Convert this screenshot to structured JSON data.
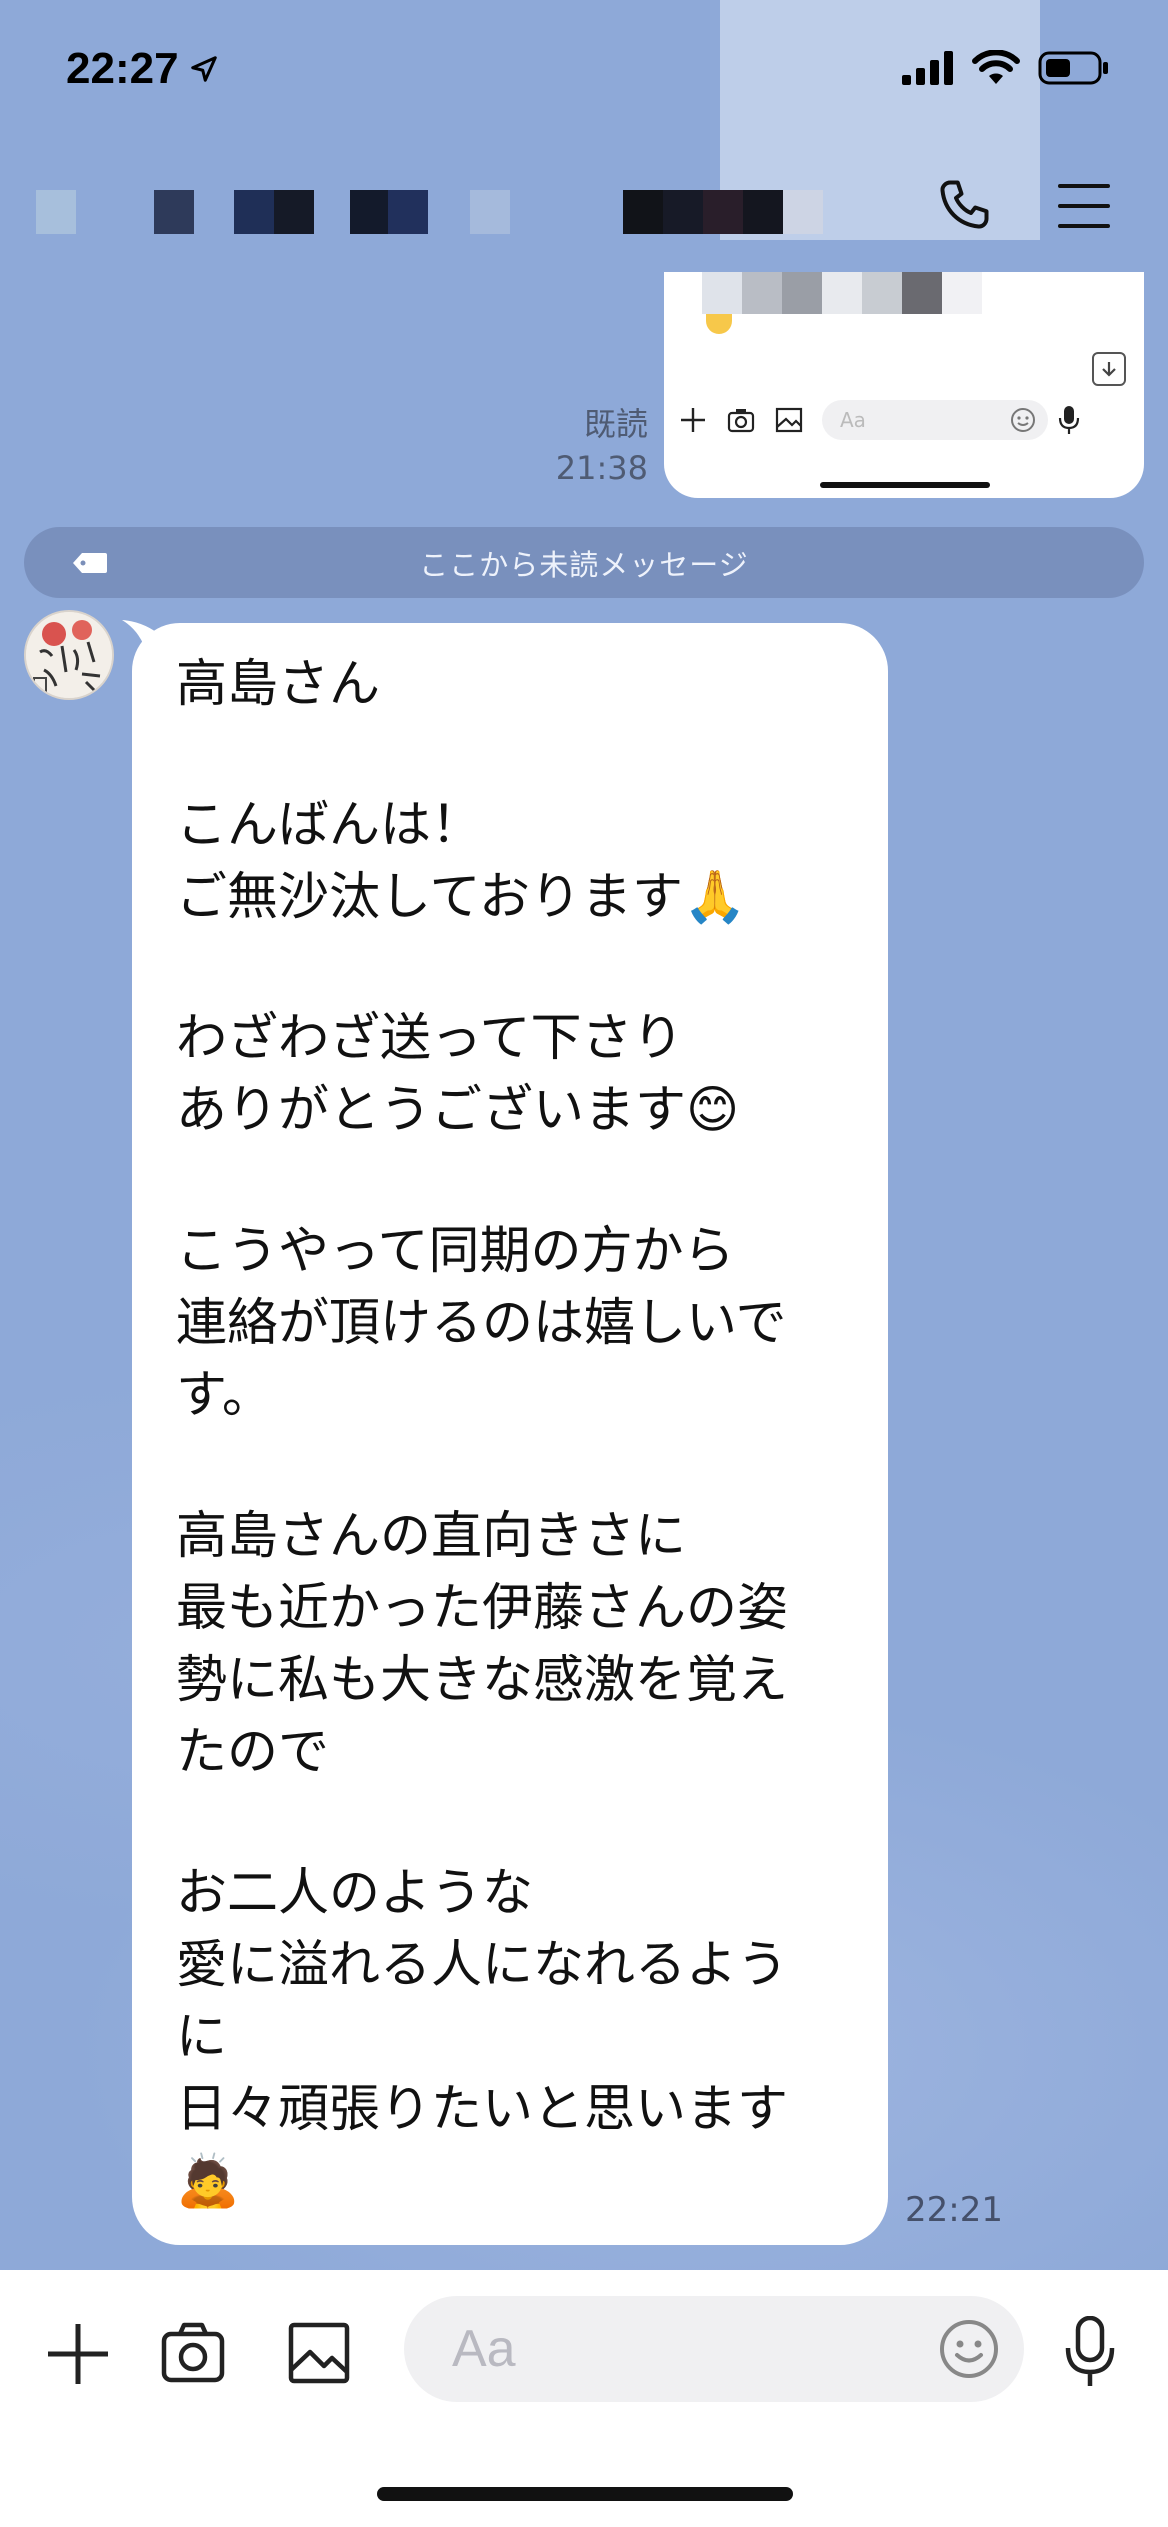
{
  "status_bar": {
    "time": "22:27",
    "icons": [
      "location-arrow-icon",
      "signal-icon",
      "wifi-icon",
      "battery-icon"
    ]
  },
  "header": {
    "title_obscured": true,
    "icons": [
      "phone-icon",
      "menu-icon"
    ]
  },
  "sent_image": {
    "read_label": "既読",
    "time": "21:38",
    "inner_placeholder": "Aa"
  },
  "unread_divider": {
    "label": "ここから未読メッセージ"
  },
  "message": {
    "lines": [
      "高島さん",
      "",
      "こんばんは！",
      "ご無沙汰しております🙏",
      "",
      "わざわざ送って下さり",
      "ありがとうございます😊",
      "",
      "こうやって同期の方から",
      "連絡が頂けるのは嬉しいで",
      "す。",
      "",
      "高島さんの直向きさに",
      "最も近かった伊藤さんの姿",
      "勢に私も大きな感激を覚え",
      "たので",
      "",
      "お二人のような",
      "愛に溢れる人になれるよう",
      "に",
      "日々頑張りたいと思います",
      "🙇"
    ],
    "time": "22:21"
  },
  "input_bar": {
    "placeholder": "Aa",
    "icons": [
      "plus-icon",
      "camera-icon",
      "image-icon",
      "emoji-icon",
      "microphone-icon"
    ]
  },
  "colors": {
    "chat_background": "#8ea9d8",
    "bubble": "#ffffff",
    "divider": "#768cb8"
  }
}
